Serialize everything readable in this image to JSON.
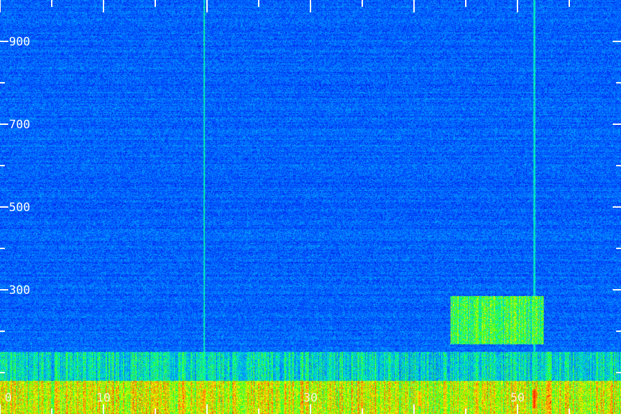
{
  "chart_data": {
    "type": "heatmap",
    "colormap": [
      "#000066",
      "#0000cc",
      "#0044ff",
      "#00aaff",
      "#00ffaa",
      "#44ff00",
      "#ffff00",
      "#ff6600",
      "#ff0000"
    ],
    "background_color": "#0a0a6e",
    "label_color": "#ffffff",
    "x_range": [
      0,
      60
    ],
    "y_range": [
      0,
      1000
    ],
    "y_ticks": [
      {
        "value": 900,
        "label": "900"
      },
      {
        "value": 700,
        "label": "700"
      },
      {
        "value": 500,
        "label": "500"
      },
      {
        "value": 300,
        "label": "300"
      }
    ],
    "y_minor_ticks": [
      800,
      600,
      400,
      200,
      100
    ],
    "x_ticks": [
      {
        "value": 0,
        "label": "0"
      },
      {
        "value": 10,
        "label": "10"
      },
      {
        "value": 20,
        "label": ""
      },
      {
        "value": 30,
        "label": "30"
      },
      {
        "value": 40,
        "label": ""
      },
      {
        "value": 50,
        "label": "50"
      }
    ],
    "x_minor_ticks": [
      5,
      15,
      25,
      35,
      45,
      55
    ],
    "grid": false,
    "features": [
      {
        "kind": "band",
        "y": [
          0,
          80
        ],
        "x": [
          0,
          60
        ],
        "intensity": 0.72
      },
      {
        "kind": "band",
        "y": [
          80,
          150
        ],
        "x": [
          0,
          60
        ],
        "intensity": 0.45
      },
      {
        "kind": "patch",
        "y": [
          170,
          285
        ],
        "x": [
          43.5,
          52.5
        ],
        "intensity": 0.58
      },
      {
        "kind": "line",
        "x": 19.7,
        "y": [
          0,
          1000
        ],
        "intensity": 0.42
      },
      {
        "kind": "line",
        "x": 51.6,
        "y": [
          0,
          1000
        ],
        "intensity": 0.4
      },
      {
        "kind": "hotspot",
        "x": 51.6,
        "y": [
          15,
          60
        ],
        "intensity": 0.95
      },
      {
        "kind": "hotspot",
        "x": 19.7,
        "y": [
          15,
          60
        ],
        "intensity": 0.85
      },
      {
        "kind": "hotspot",
        "x": 40.5,
        "y": [
          20,
          55
        ],
        "intensity": 0.85
      }
    ]
  }
}
